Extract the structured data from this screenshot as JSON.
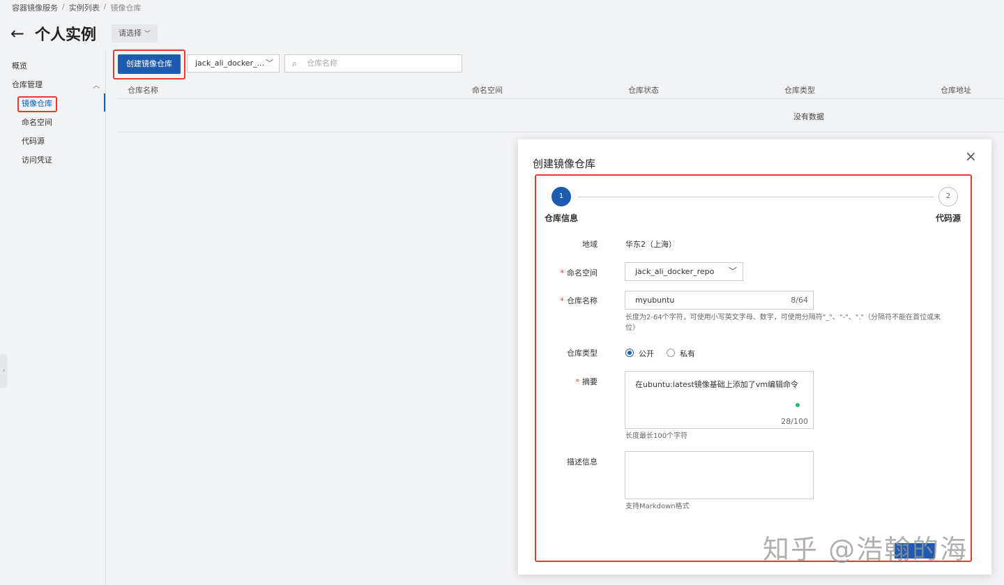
{
  "breadcrumb": [
    "容器镜像服务",
    "实例列表",
    "镜像仓库"
  ],
  "breadcrumb_separator": "/",
  "page": {
    "title": "个人实例",
    "instance_select": "请选择"
  },
  "sidebar": {
    "items": [
      {
        "label": "概览"
      },
      {
        "label": "仓库管理"
      },
      {
        "label": "镜像仓库"
      },
      {
        "label": "命名空间"
      },
      {
        "label": "代码源"
      },
      {
        "label": "访问凭证"
      }
    ]
  },
  "toolbar": {
    "create_button": "创建镜像仓库",
    "namespace_select": "jack_ali_docker_...",
    "search_placeholder": "仓库名称"
  },
  "table": {
    "columns": [
      "仓库名称",
      "命名空间",
      "仓库状态",
      "仓库类型",
      "仓库地址"
    ],
    "empty_text": "没有数据"
  },
  "modal": {
    "title": "创建镜像仓库",
    "close": "×",
    "steps": [
      {
        "number": "1",
        "label": "仓库信息"
      },
      {
        "number": "2",
        "label": "代码源"
      }
    ],
    "region_label": "地域",
    "region_value": "华东2（上海）",
    "namespace_label": "命名空间",
    "namespace_value": "jack_ali_docker_repo",
    "repo_name_label": "仓库名称",
    "repo_name_value": "myubuntu",
    "repo_name_count": "8/64",
    "repo_name_hint": "长度为2-64个字符，可使用小写英文字母、数字，可使用分隔符\"_\"、\"-\"、\".\"（分隔符不能在首位或末位）",
    "repo_type_label": "仓库类型",
    "repo_type_options": [
      "公开",
      "私有"
    ],
    "repo_type_selected": "公开",
    "summary_label": "摘要",
    "summary_value": "在ubuntu:latest镜像基础上添加了vm编辑命令",
    "summary_count": "28/100",
    "summary_hint": "长度最长100个字符",
    "description_label": "描述信息",
    "description_value": "",
    "description_hint": "支持Markdown格式"
  },
  "watermark": "知乎 @浩翰的海",
  "colors": {
    "accent": "#1c5bb0",
    "highlight": "#e53935",
    "background": "#f2f3f5"
  }
}
